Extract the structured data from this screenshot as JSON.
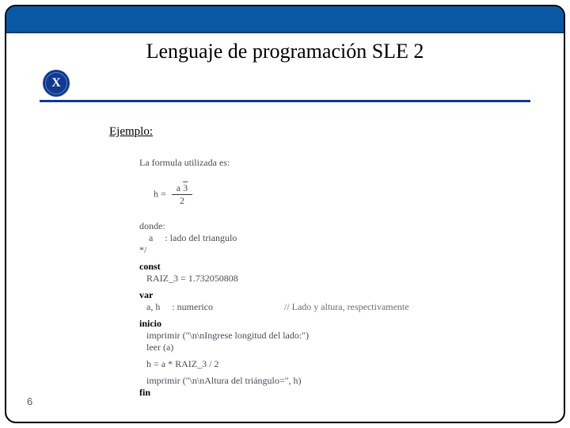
{
  "title": "Lenguaje de programación SLE 2",
  "logo_letter": "X",
  "ejemplo_label": "Ejemplo:",
  "code": {
    "c1": "La formula utilizada es:",
    "frac_lhs": "h = ",
    "frac_num_a": "a",
    "frac_num_rt": "3",
    "frac_den": "2",
    "c3": "donde:",
    "c4": "    a     : lado del triangulo",
    "c5": "*/",
    "kw_const": "const",
    "c6": "   RAIZ_3 = 1.732050808",
    "kw_var": "var",
    "c7_left": "   a, h     : numerico",
    "c7_right": "// Lado y altura, respectivamente",
    "kw_inicio": "inicio",
    "c8": "   imprimir (\"\\n\\nIngrese longitud del lado:\")",
    "c9": "   leer (a)",
    "c10": "   h = a * RAIZ_3 / 2",
    "c11": "   imprimir (\"\\n\\nAltura del triángulo=\", h)",
    "kw_fin": "fin"
  },
  "page_number": "6"
}
